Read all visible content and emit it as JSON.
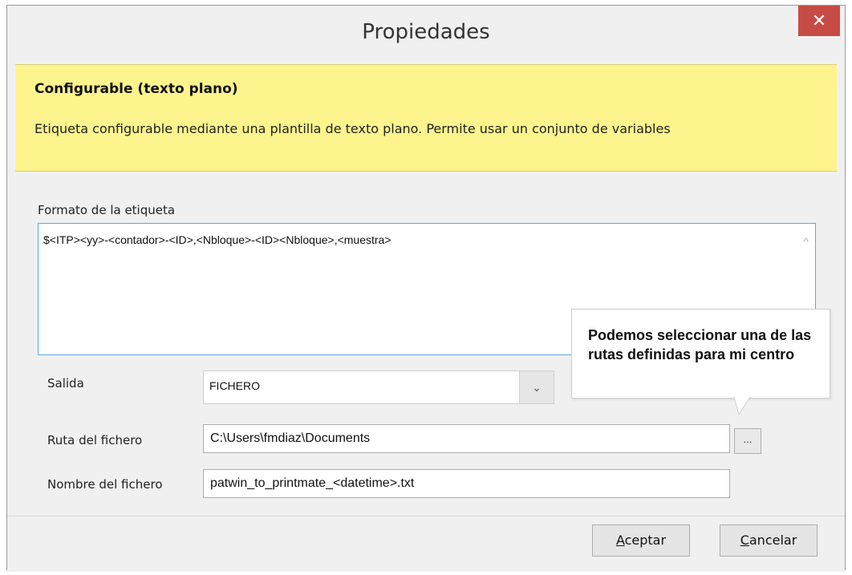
{
  "window": {
    "title": "Propiedades"
  },
  "banner": {
    "title": "Configurable (texto plano)",
    "description": "Etiqueta configurable mediante una plantilla de texto plano. Permite usar un conjunto de variables"
  },
  "format": {
    "label": "Formato de la etiqueta",
    "value": "$<ITP><yy>-<contador>-<ID>,<Nbloque>-<ID><Nbloque>,<muestra>"
  },
  "output": {
    "label": "Salida",
    "selected": "FICHERO"
  },
  "file_path": {
    "label": "Ruta del fichero",
    "value": "C:\\Users\\fmdiaz\\Documents",
    "browse_label": "..."
  },
  "file_name": {
    "label": "Nombre del fichero",
    "value": "patwin_to_printmate_<datetime>.txt"
  },
  "callout": {
    "text": "Podemos seleccionar una de las rutas definidas para mi centro"
  },
  "buttons": {
    "accept_mnemonic": "A",
    "accept_rest": "ceptar",
    "cancel_mnemonic": "C",
    "cancel_rest": "ancelar"
  },
  "icons": {
    "close": "close-icon",
    "dropdown": "chevron-down-icon",
    "scroll_up": "scroll-up-icon"
  },
  "colors": {
    "banner_bg": "#fdf48d",
    "close_bg": "#c74b45",
    "focus_border": "#5aa8e6"
  }
}
